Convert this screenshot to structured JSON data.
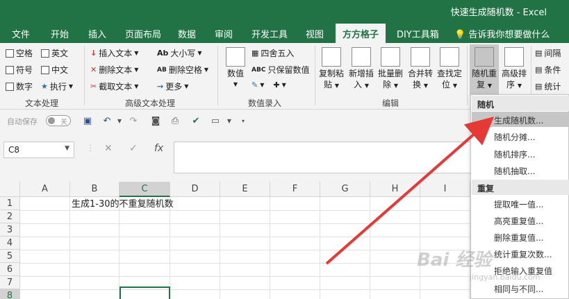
{
  "window": {
    "title": "快速生成随机数 - Excel"
  },
  "tabs": [
    "文件",
    "开始",
    "插入",
    "页面布局",
    "数据",
    "审阅",
    "开发工具",
    "视图",
    "方方格子",
    "DIY工具箱",
    "告诉我你想要做什么"
  ],
  "active_tab": "方方格子",
  "ribbon": {
    "text_processing": {
      "items": [
        "空格",
        "英文",
        "符号",
        "中文",
        "数字",
        "执行"
      ],
      "label": "文本处理"
    },
    "advanced_text": {
      "items": [
        "插入文本",
        "删除文本",
        "截取文本",
        "大小写",
        "删除空格",
        "更多"
      ],
      "label": "高级文本处理"
    },
    "value_entry": {
      "items": [
        "数值",
        "四舍五入",
        "只保留数值"
      ],
      "label": "数值录入"
    },
    "edit": {
      "buttons": [
        {
          "l1": "复制粘",
          "l2": "贴"
        },
        {
          "l1": "新增插",
          "l2": "入"
        },
        {
          "l1": "批量删",
          "l2": "除"
        },
        {
          "l1": "合并转",
          "l2": "换"
        },
        {
          "l1": "查找定",
          "l2": "位"
        }
      ],
      "label": "编辑"
    },
    "random": {
      "l1": "随机重",
      "l2": "复"
    },
    "sort": {
      "l1": "高级排",
      "l2": "序"
    },
    "right_items": [
      "间隔",
      "条件",
      "统计"
    ]
  },
  "qat": {
    "autosave": "自动保存",
    "toggle": "关"
  },
  "formula_bar": {
    "name_box": "C8",
    "cancel": "✕",
    "enter": "✓",
    "fx": "fx",
    "content": ""
  },
  "columns": [
    "A",
    "B",
    "C",
    "D",
    "E",
    "F",
    "G",
    "H",
    "I"
  ],
  "active_column": "C",
  "rows": [
    "1",
    "2",
    "3",
    "4",
    "5",
    "6",
    "7",
    "8"
  ],
  "active_row": "8",
  "cells": {
    "B1": "生成1-30的不重复随机数"
  },
  "menu": {
    "section1": "随机",
    "items1": [
      "生成随机数...",
      "随机分摊...",
      "随机排序...",
      "随机抽取..."
    ],
    "highlighted": "生成随机数...",
    "section2": "重复",
    "items2": [
      "提取唯一值...",
      "高亮重复值...",
      "删除重复值...",
      "统计重复次数...",
      "拒绝输入重复值",
      "相同与不同..."
    ]
  },
  "watermark": {
    "logo": "Bai 经验",
    "url": "jingyan.baidu.com"
  },
  "colors": {
    "excel_green": "#217346",
    "arrow_red": "#e53935"
  }
}
